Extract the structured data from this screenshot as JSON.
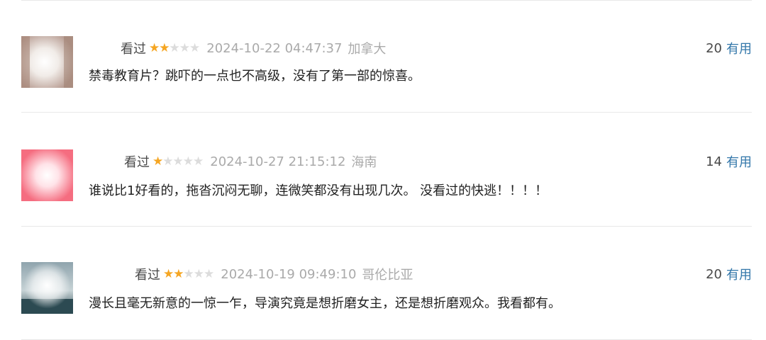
{
  "colors": {
    "star_on": "#f5a623",
    "star_off": "#dcdcdc",
    "link": "#3377aa",
    "meta_gray": "#aaaaaa",
    "text": "#222222"
  },
  "comments": [
    {
      "status": "看过",
      "rating": 2,
      "rating_max": 5,
      "time": "2024-10-22 04:47:37",
      "location": "加拿大",
      "votes": "20",
      "vote_label": "有用",
      "text": "禁毒教育片？跳吓的一点也不高级，没有了第一部的惊喜。"
    },
    {
      "status": "看过",
      "rating": 1,
      "rating_max": 5,
      "time": "2024-10-27 21:15:12",
      "location": "海南",
      "votes": "14",
      "vote_label": "有用",
      "text": "谁说比1好看的，拖沓沉闷无聊，连微笑都没有出现几次。 没看过的快逃！！！！"
    },
    {
      "status": "看过",
      "rating": 2,
      "rating_max": 5,
      "time": "2024-10-19 09:49:10",
      "location": "哥伦比亚",
      "votes": "20",
      "vote_label": "有用",
      "text": "漫长且毫无新意的一惊一乍，导演究竟是想折磨女主，还是想折磨观众。我看都有。"
    }
  ]
}
